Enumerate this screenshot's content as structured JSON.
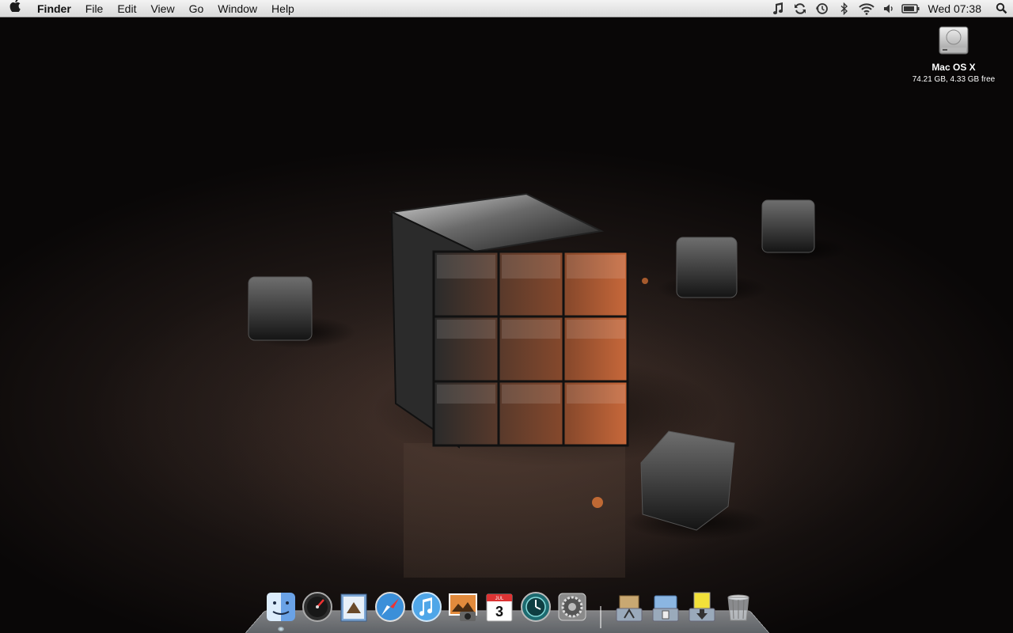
{
  "menubar": {
    "apple_icon": "apple-logo-icon",
    "app_name": "Finder",
    "menus": [
      "File",
      "Edit",
      "View",
      "Go",
      "Window",
      "Help"
    ],
    "status_icons": [
      "itunes-note-icon",
      "sync-icon",
      "time-machine-icon",
      "bluetooth-icon",
      "wifi-icon",
      "volume-icon",
      "battery-icon"
    ],
    "clock": "Wed 07:38",
    "spotlight_icon": "spotlight-search-icon"
  },
  "desktop": {
    "drive": {
      "name": "Mac OS X",
      "info": "74.21 GB, 4.33 GB free",
      "icon": "hard-drive-icon"
    },
    "wallpaper": "dark-cubes"
  },
  "dock": {
    "apps": [
      {
        "name": "Finder",
        "icon": "finder-icon"
      },
      {
        "name": "Dashboard",
        "icon": "dashboard-icon"
      },
      {
        "name": "Mail",
        "icon": "mail-icon"
      },
      {
        "name": "Safari",
        "icon": "safari-icon"
      },
      {
        "name": "iTunes",
        "icon": "itunes-icon"
      },
      {
        "name": "iPhoto",
        "icon": "iphoto-icon"
      },
      {
        "name": "iCal",
        "icon": "ical-icon",
        "date": "3",
        "month": "JUL"
      },
      {
        "name": "Time Machine",
        "icon": "time-machine-icon"
      },
      {
        "name": "System Preferences",
        "icon": "system-preferences-icon"
      }
    ],
    "stacks": [
      {
        "name": "Applications",
        "icon": "applications-stack-icon"
      },
      {
        "name": "Documents",
        "icon": "documents-stack-icon"
      },
      {
        "name": "Downloads",
        "icon": "downloads-stack-icon"
      },
      {
        "name": "Trash",
        "icon": "trash-icon"
      }
    ]
  },
  "colors": {
    "menubar_top": "#f3f3f3",
    "menubar_bottom": "#d9d9d9",
    "cube_highlight": "#c8683a",
    "background": "#000000"
  }
}
